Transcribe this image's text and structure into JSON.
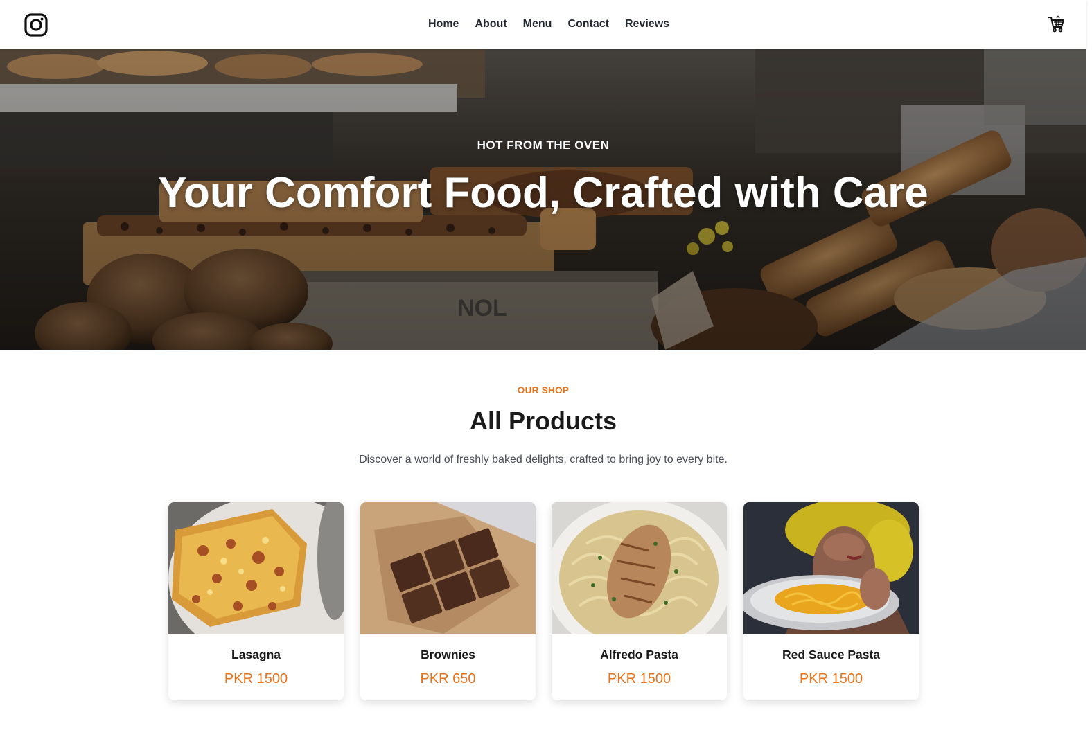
{
  "header": {
    "instagram_icon": "instagram-icon",
    "cart_icon": "cart-icon",
    "nav": [
      "Home",
      "About",
      "Menu",
      "Contact",
      "Reviews"
    ]
  },
  "hero": {
    "kicker": "HOT FROM THE OVEN",
    "title": "Your Comfort Food, Crafted with Care"
  },
  "shop": {
    "eyebrow": "OUR SHOP",
    "title": "All Products",
    "subtitle": "Discover a world of freshly baked delights, crafted to bring joy to every bite."
  },
  "products": [
    {
      "name": "Lasagna",
      "price": "PKR 1500"
    },
    {
      "name": "Brownies",
      "price": "PKR 650"
    },
    {
      "name": "Alfredo Pasta",
      "price": "PKR 1500"
    },
    {
      "name": "Red Sauce Pasta",
      "price": "PKR 1500"
    }
  ],
  "colors": {
    "accent": "#e8731a",
    "nav_text": "#222831",
    "heading": "#1a1a1a",
    "subtext": "#4a4f57"
  }
}
